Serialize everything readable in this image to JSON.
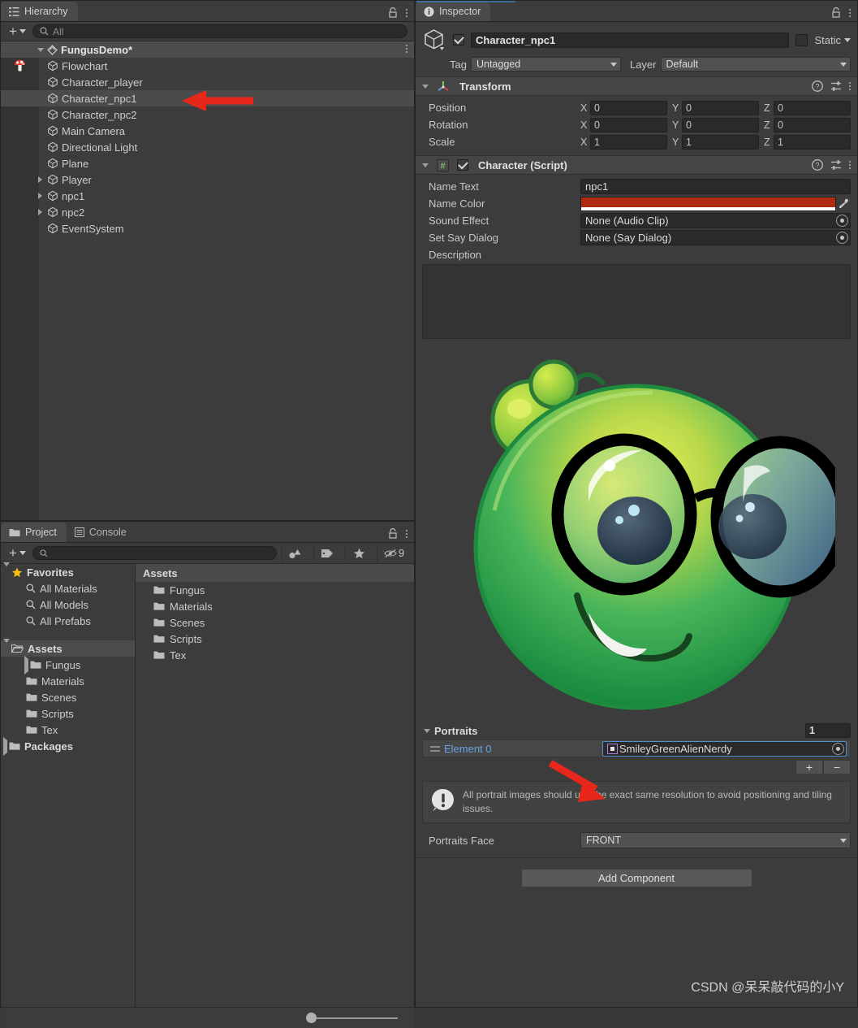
{
  "hierarchy": {
    "tab_label": "Hierarchy",
    "tab_icon": "hierarchy-icon",
    "add_label": "+",
    "search_placeholder": "All",
    "search_value": "",
    "scene_name": "FungusDemo*",
    "items": [
      {
        "label": "Flowchart",
        "icon": "gameobject-icon",
        "badge": "mushroom-icon",
        "foldout": "none",
        "indent": 1,
        "selected": false
      },
      {
        "label": "Character_player",
        "icon": "gameobject-icon",
        "badge": "",
        "foldout": "none",
        "indent": 1,
        "selected": false
      },
      {
        "label": "Character_npc1",
        "icon": "gameobject-icon",
        "badge": "",
        "foldout": "none",
        "indent": 1,
        "selected": true
      },
      {
        "label": "Character_npc2",
        "icon": "gameobject-icon",
        "badge": "",
        "foldout": "none",
        "indent": 1,
        "selected": false
      },
      {
        "label": "Main Camera",
        "icon": "gameobject-icon",
        "badge": "",
        "foldout": "none",
        "indent": 1,
        "selected": false
      },
      {
        "label": "Directional Light",
        "icon": "gameobject-icon",
        "badge": "",
        "foldout": "none",
        "indent": 1,
        "selected": false
      },
      {
        "label": "Plane",
        "icon": "gameobject-icon",
        "badge": "",
        "foldout": "none",
        "indent": 1,
        "selected": false
      },
      {
        "label": "Player",
        "icon": "gameobject-icon",
        "badge": "",
        "foldout": "closed",
        "indent": 1,
        "selected": false
      },
      {
        "label": "npc1",
        "icon": "gameobject-icon",
        "badge": "",
        "foldout": "closed",
        "indent": 1,
        "selected": false
      },
      {
        "label": "npc2",
        "icon": "gameobject-icon",
        "badge": "",
        "foldout": "closed",
        "indent": 1,
        "selected": false
      },
      {
        "label": "EventSystem",
        "icon": "gameobject-icon",
        "badge": "",
        "foldout": "none",
        "indent": 1,
        "selected": false
      }
    ]
  },
  "project": {
    "tabs": [
      {
        "label": "Project",
        "icon": "folder-icon",
        "active": true
      },
      {
        "label": "Console",
        "icon": "console-icon",
        "active": false
      }
    ],
    "search_placeholder": "",
    "search_value": "",
    "filter_buttons": [
      "type-filter-icon",
      "label-filter-icon",
      "favorite-filter-icon"
    ],
    "hidden_count": "9",
    "tree": [
      {
        "label": "Favorites",
        "icon": "star-icon",
        "foldout": "open",
        "indent": 0,
        "bold": true,
        "selected": false
      },
      {
        "label": "All Materials",
        "icon": "search-icon",
        "foldout": "none",
        "indent": 1,
        "bold": false,
        "selected": false
      },
      {
        "label": "All Models",
        "icon": "search-icon",
        "foldout": "none",
        "indent": 1,
        "bold": false,
        "selected": false
      },
      {
        "label": "All Prefabs",
        "icon": "search-icon",
        "foldout": "none",
        "indent": 1,
        "bold": false,
        "selected": false
      },
      {
        "label": "",
        "icon": "",
        "foldout": "none",
        "indent": 0,
        "bold": false,
        "selected": false
      },
      {
        "label": "Assets",
        "icon": "folder-open-icon",
        "foldout": "open",
        "indent": 0,
        "bold": true,
        "selected": true
      },
      {
        "label": "Fungus",
        "icon": "folder-icon",
        "foldout": "closed",
        "indent": 1,
        "bold": false,
        "selected": false
      },
      {
        "label": "Materials",
        "icon": "folder-icon",
        "foldout": "none",
        "indent": 1,
        "bold": false,
        "selected": false
      },
      {
        "label": "Scenes",
        "icon": "folder-icon",
        "foldout": "none",
        "indent": 1,
        "bold": false,
        "selected": false
      },
      {
        "label": "Scripts",
        "icon": "folder-icon",
        "foldout": "none",
        "indent": 1,
        "bold": false,
        "selected": false
      },
      {
        "label": "Tex",
        "icon": "folder-icon",
        "foldout": "none",
        "indent": 1,
        "bold": false,
        "selected": false
      },
      {
        "label": "Packages",
        "icon": "folder-icon",
        "foldout": "closed",
        "indent": 0,
        "bold": true,
        "selected": false
      }
    ],
    "content_header": "Assets",
    "content_items": [
      {
        "label": "Fungus",
        "icon": "folder-icon"
      },
      {
        "label": "Materials",
        "icon": "folder-icon"
      },
      {
        "label": "Scenes",
        "icon": "folder-icon"
      },
      {
        "label": "Scripts",
        "icon": "folder-icon"
      },
      {
        "label": "Tex",
        "icon": "folder-icon"
      }
    ],
    "zoom_value": 12
  },
  "inspector": {
    "tab_label": "Inspector",
    "tab_icon": "info-icon",
    "gameobject": {
      "enabled": true,
      "name": "Character_npc1",
      "static_label": "Static",
      "static_checked": false,
      "tag_label": "Tag",
      "tag_value": "Untagged",
      "layer_label": "Layer",
      "layer_value": "Default"
    },
    "transform": {
      "title": "Transform",
      "expanded": true,
      "rows": [
        {
          "label": "Position",
          "x": "0",
          "y": "0",
          "z": "0"
        },
        {
          "label": "Rotation",
          "x": "0",
          "y": "0",
          "z": "0"
        },
        {
          "label": "Scale",
          "x": "1",
          "y": "1",
          "z": "1"
        }
      ],
      "axis_labels": [
        "X",
        "Y",
        "Z"
      ]
    },
    "character_script": {
      "title": "Character (Script)",
      "enabled": true,
      "expanded": true,
      "name_text_label": "Name Text",
      "name_text_value": "npc1",
      "name_color_label": "Name Color",
      "name_color_value": "#B02B10",
      "name_color_alpha": "#FFFFFF",
      "sound_effect_label": "Sound Effect",
      "sound_effect_value": "None (Audio Clip)",
      "set_say_dialog_label": "Set Say Dialog",
      "set_say_dialog_value": "None (Say Dialog)",
      "description_label": "Description",
      "description_value": ""
    },
    "portraits": {
      "title": "Portraits",
      "size": "1",
      "elements": [
        {
          "label": "Element 0",
          "value": "SmileyGreenAlienNerdy"
        }
      ],
      "add_label": "+",
      "remove_label": "−",
      "help_text": "All portrait images should use the exact same resolution to avoid positioning and tiling issues.",
      "face_label": "Portraits Face",
      "face_value": "FRONT"
    },
    "add_component_label": "Add Component"
  },
  "watermark": "CSDN @呆呆敲代码的小Y",
  "colors": {
    "panel_bg": "#3c3c3c",
    "header_bg": "#454545",
    "field_bg": "#2a2a2a",
    "selection": "#4b4b4b",
    "accent_blue": "#3f6c9e",
    "link_blue": "#68a3e0",
    "annotation_red": "#e8261a",
    "name_color": "#B02B10"
  }
}
